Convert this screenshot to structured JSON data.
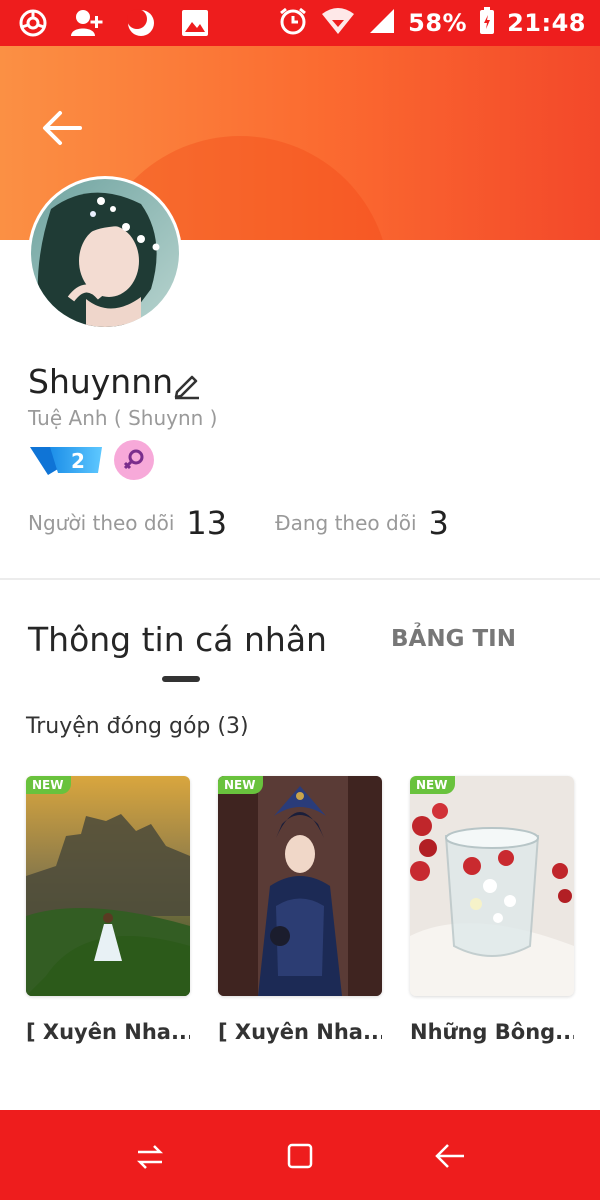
{
  "status_bar": {
    "battery": "58%",
    "time": "21:48",
    "left_icons": [
      "app-icon",
      "add-user-icon",
      "moon-icon",
      "image-icon"
    ],
    "right_icons": [
      "alarm-icon",
      "wifi-icon",
      "signal-icon",
      "battery-icon"
    ]
  },
  "profile": {
    "username": "Shuynnn",
    "full_name": "Tuệ Anh ( Shuynn )",
    "level": "2",
    "followers_label": "Người theo dõi",
    "followers_count": "13",
    "following_label": "Đang theo dõi",
    "following_count": "3"
  },
  "tabs": {
    "active": "Thông tin cá nhân",
    "inactive": "BẢNG TIN"
  },
  "contributions": {
    "title": "Truyện đóng góp (3)",
    "items": [
      {
        "badge": "NEW",
        "title": "[ Xuyên Nha..."
      },
      {
        "badge": "NEW",
        "title": "[ Xuyên Nha..."
      },
      {
        "badge": "NEW",
        "title": "Những Bông..."
      }
    ]
  },
  "colors": {
    "status_bar": "#ee1d1d",
    "header_gradient_start": "#fb9044",
    "header_gradient_end": "#f3482a",
    "new_badge": "#69c23d",
    "nav_bar": "#ee1d1d"
  }
}
